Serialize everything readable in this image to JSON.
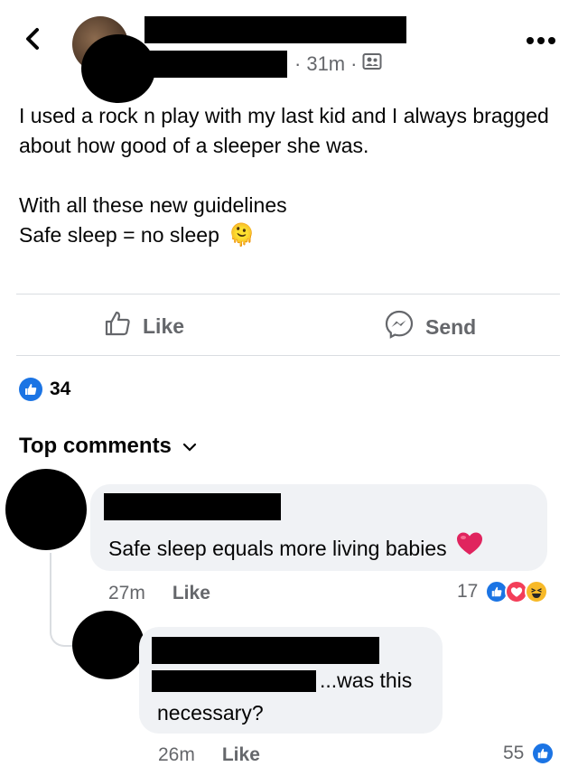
{
  "post": {
    "time": "31m",
    "separator": "·",
    "paragraph1": "I used a rock n play with my last kid and I always bragged about how good of a sleeper she was.",
    "paragraph2_line1": "With all these new guidelines",
    "paragraph2_line2": "Safe sleep = no sleep",
    "emoji": "🫠"
  },
  "actions": {
    "like_label": "Like",
    "send_label": "Send"
  },
  "reactions": {
    "count": "34"
  },
  "comments_header": {
    "label": "Top comments"
  },
  "comments": [
    {
      "text": "Safe sleep equals more living babies",
      "emoji": "❤️",
      "time": "27m",
      "like_label": "Like",
      "reaction_count": "17"
    },
    {
      "text_line1": "...was this",
      "text_line2": "necessary?",
      "time": "26m",
      "like_label": "Like",
      "reaction_count": "55"
    }
  ],
  "colors": {
    "like_blue": "#1b74e4",
    "love_red": "#f33e58",
    "haha_yellow": "#f7b928",
    "muted_text": "#65676b",
    "bubble_bg": "#f0f2f5"
  },
  "icons": [
    "back-chevron-icon",
    "more-dots-icon",
    "audience-icon",
    "thumbs-up-icon",
    "messenger-icon",
    "chevron-down-icon",
    "like-reaction-icon",
    "love-reaction-icon",
    "haha-reaction-icon"
  ]
}
